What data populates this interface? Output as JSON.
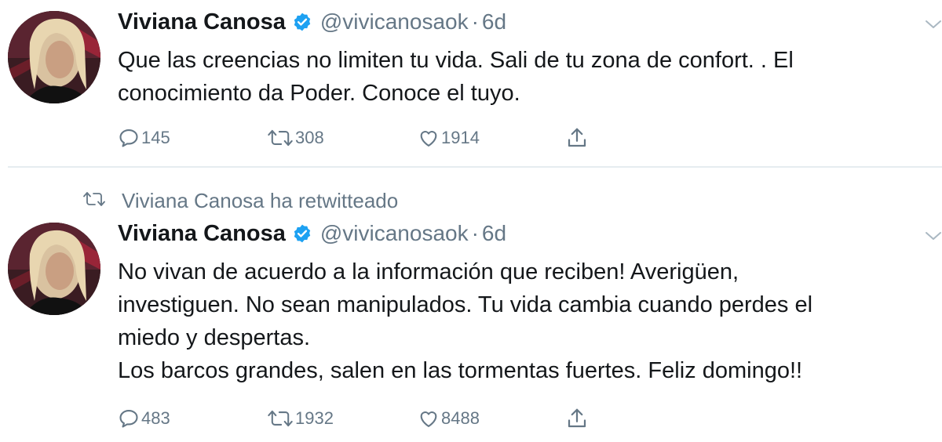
{
  "tweets": [
    {
      "author_name": "Viviana Canosa",
      "handle": "@vivicanosaok",
      "separator": "·",
      "time": "6d",
      "lines": [
        "Que las creencias no limiten tu vida. Sali de tu zona de confort. . El",
        "conocimiento da Poder. Conoce el tuyo."
      ],
      "replies": "145",
      "retweets": "308",
      "likes": "1914"
    },
    {
      "retweeted_by": "Viviana Canosa ha retwitteado",
      "author_name": "Viviana Canosa",
      "handle": "@vivicanosaok",
      "separator": "·",
      "time": "6d",
      "lines": [
        "No vivan de acuerdo a la información que reciben! Averigüen,",
        "investiguen. No sean manipulados. Tu vida cambia cuando perdes el",
        "miedo y despertas.",
        "Los barcos grandes, salen en las tormentas fuertes. Feliz domingo!!"
      ],
      "replies": "483",
      "retweets": "1932",
      "likes": "8488"
    }
  ],
  "colors": {
    "text": "#14171a",
    "secondary": "#657786",
    "verified": "#1da1f2",
    "divider": "#e6ecf0"
  },
  "icons": [
    "verified-badge-icon",
    "chevron-down-icon",
    "reply-icon",
    "retweet-icon",
    "like-icon",
    "share-icon"
  ]
}
